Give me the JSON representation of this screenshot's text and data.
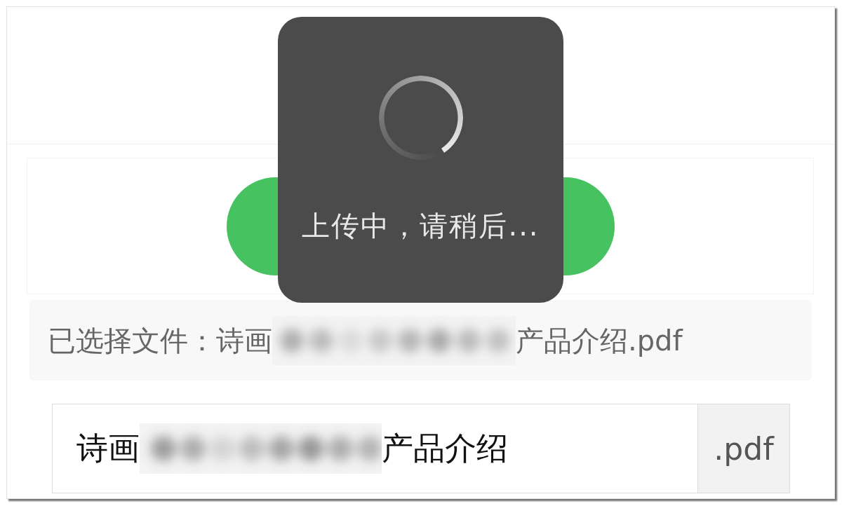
{
  "selected_file": {
    "text_parts": [
      "已选择文件：诗画",
      "产品介绍.pdf"
    ]
  },
  "file_name_input": {
    "value_parts": [
      "诗画",
      "产品介绍"
    ],
    "suffix": ".pdf"
  },
  "toast": {
    "message": "上传中，请稍后..."
  }
}
